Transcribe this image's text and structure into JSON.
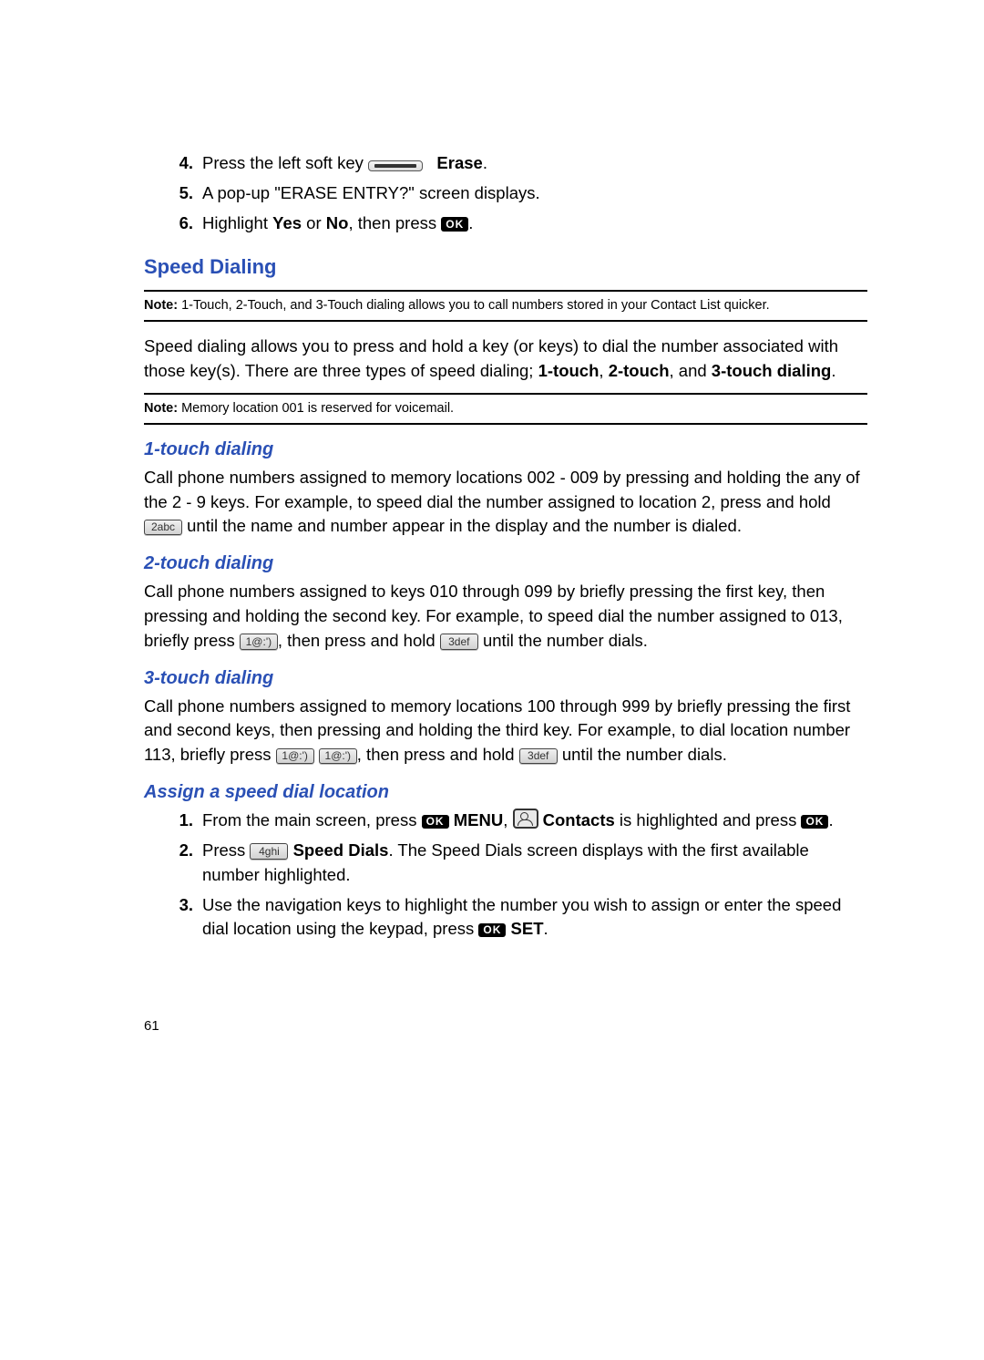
{
  "top_list": {
    "items": [
      {
        "num": "4.",
        "pre": "Press the left soft key ",
        "post": "Erase",
        "tail": "."
      },
      {
        "num": "5.",
        "text": "A pop-up \"ERASE ENTRY?\" screen displays."
      },
      {
        "num": "6.",
        "pre": "Highlight ",
        "b1": "Yes",
        "mid1": " or ",
        "b2": "No",
        "mid2": ", then press ",
        "tail": "."
      }
    ]
  },
  "h_speed": "Speed Dialing",
  "note1": {
    "label": "Note:",
    "text": " 1-Touch, 2-Touch, and 3-Touch dialing allows you to call numbers stored in your Contact List quicker."
  },
  "speed_intro": {
    "p1a": "Speed dialing allows you to press and hold a key (or keys) to dial the number associated with those key(s). There are three types of speed dialing; ",
    "b1": "1-touch",
    "p1b": ", ",
    "b2": "2-touch",
    "p1c": ", and ",
    "b3": "3-touch dialing",
    "p1d": "."
  },
  "note2": {
    "label": "Note:",
    "text": " Memory location 001 is reserved for voicemail."
  },
  "s1": {
    "heading": "1-touch dialing",
    "p_a": "Call phone numbers assigned to memory locations 002 - 009 by pressing and holding the any of the 2 - 9 keys. For example, to speed dial the number assigned to location 2, press and hold ",
    "key2": "2abc",
    "p_b": " until the name and number appear in the display and the number is dialed."
  },
  "s2": {
    "heading": "2-touch dialing",
    "p_a": "Call phone numbers assigned to keys 010 through 099 by briefly pressing the first key, then pressing and holding the second key. For example, to speed dial the number assigned to 013, briefly press ",
    "key1": "1@:')",
    "p_b": ", then press and hold ",
    "key3": "3def",
    "p_c": " until the number dials."
  },
  "s3": {
    "heading": "3-touch dialing",
    "p_a": "Call phone numbers assigned to memory locations 100 through 999 by briefly pressing the first and second keys, then pressing and holding the third key. For example, to dial location number 113, briefly press ",
    "key1a": "1@:')",
    "key1b": "1@:')",
    "p_b": ", then press and hold ",
    "key3": "3def",
    "p_c": " until the number dials."
  },
  "s4": {
    "heading": "Assign a speed dial location",
    "items": [
      {
        "num": "1.",
        "a": "From the main screen, press ",
        "menu": "MENU",
        "b": ", ",
        "contacts": "Contacts",
        "c": " is highlighted and press ",
        "d": "."
      },
      {
        "num": "2.",
        "a": "Press ",
        "key4": "4ghi",
        "sd": "Speed Dials",
        "b": ". The Speed Dials screen displays with the first available number highlighted."
      },
      {
        "num": "3.",
        "a": "Use the navigation keys to highlight the number you wish to assign or enter the speed dial location using the keypad, press ",
        "set": "SET",
        "b": "."
      }
    ]
  },
  "page_number": "61",
  "icons": {
    "ok": "OK"
  }
}
